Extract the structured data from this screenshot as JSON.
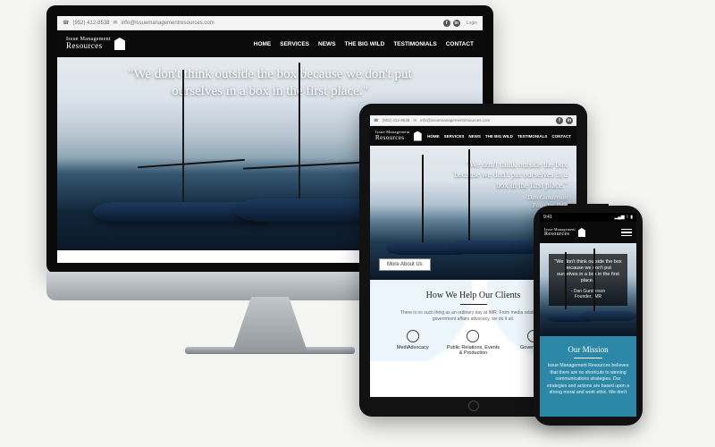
{
  "brand": {
    "line1": "Issue Management",
    "line2": "Resources"
  },
  "topbar": {
    "phone": "(952) 412-8538",
    "email": "info@issuemanagementresources.com",
    "login": "Login",
    "facebook_icon": "f",
    "linkedin_icon": "in"
  },
  "nav": [
    "HOME",
    "SERVICES",
    "NEWS",
    "THE BIG WILD",
    "TESTIMONIALS",
    "CONTACT"
  ],
  "hero": {
    "desktop_quote": "\"We don't think outside the box because we don't put ourselves in a box in the first place.\"",
    "tablet_quote": "\"We don't think outside the box because we don't put ourselves in a box in the first place.\"",
    "attribution_name": "- Dan Gunderson",
    "attribution_role": "Founder, IMR",
    "more_button": "More About Us"
  },
  "help": {
    "title": "How We Help Our Clients",
    "subtitle": "There is no such thing as an ordinary day at IMR. From media relations to government affairs advocacy, we do it all.",
    "columns": [
      {
        "title": "MediAdvocacy"
      },
      {
        "title": "Public Relations, Events & Production"
      },
      {
        "title": "Government"
      }
    ]
  },
  "phone": {
    "time": "9:41",
    "quote": "\"We don't think outside the box because we don't put ourselves in a box in the first place.\"",
    "mission_title": "Our Mission",
    "mission_body": "Issue Management Resources believes that there are no shortcuts to winning communications strategies. Our strategies and actions are based upon a strong moral and work ethic. We don't"
  }
}
